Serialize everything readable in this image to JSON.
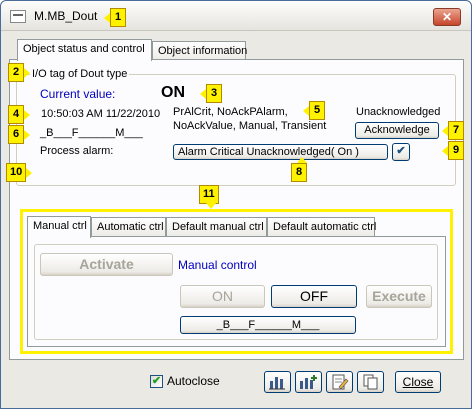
{
  "window": {
    "title": "M.MB_Dout",
    "close_glyph": "✕"
  },
  "badges": [
    "1",
    "2",
    "3",
    "4",
    "5",
    "6",
    "7",
    "8",
    "9",
    "10",
    "11"
  ],
  "tabs_top": [
    "Object status and control",
    "Object information"
  ],
  "status": {
    "io_tag": "I/O tag of Dout type",
    "current_value_label": "Current value:",
    "current_value": "ON",
    "timestamp": "10:50:03 AM 11/22/2010",
    "flags_line1": "PrAlCrit, NoAckPAlarm,",
    "flags_line2": "NoAckValue, Manual, Transient",
    "ack_state": "Unacknowledged",
    "acknowledge_label": "Acknowledge",
    "flag_string": "_B___F______M___",
    "process_alarm_label": "Process alarm:",
    "process_alarm_value": "Alarm Critical Unacknowledged( On )",
    "check_glyph": "✔"
  },
  "tabs_bottom": [
    "Manual ctrl",
    "Automatic ctrl",
    "Default manual ctrl",
    "Default automatic ctrl"
  ],
  "manual": {
    "activate_label": "Activate",
    "mode_label": "Manual control",
    "on_label": "ON",
    "off_label": "OFF",
    "execute_label": "Execute",
    "flag_button_label": "_B___F______M___"
  },
  "footer": {
    "autoclose_label": "Autoclose",
    "autoclose_checked": true,
    "check_glyph": "✔",
    "close_label": "Close"
  },
  "colors": {
    "accent_blue": "#0000c0",
    "highlight_yellow": "#fff200"
  }
}
